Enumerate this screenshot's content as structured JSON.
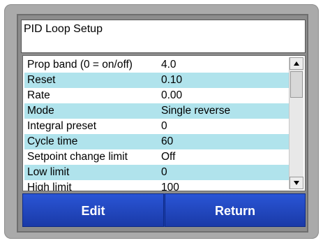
{
  "window": {
    "title": "PID Loop Setup"
  },
  "settings": [
    {
      "label": "Prop band (0 = on/off)",
      "value": "4.0"
    },
    {
      "label": "Reset",
      "value": "0.10"
    },
    {
      "label": "Rate",
      "value": "0.00"
    },
    {
      "label": "Mode",
      "value": "Single reverse"
    },
    {
      "label": "Integral preset",
      "value": "0"
    },
    {
      "label": "Cycle time",
      "value": "60"
    },
    {
      "label": "Setpoint change limit",
      "value": "Off"
    },
    {
      "label": "Low limit",
      "value": "0"
    },
    {
      "label": "High limit",
      "value": "100"
    }
  ],
  "scrollbar": {
    "up_icon": "triangle-up",
    "down_icon": "triangle-down"
  },
  "buttons": {
    "edit_label": "Edit",
    "return_label": "Return"
  },
  "colors": {
    "row_highlight": "#b0e3ec",
    "button_blue": "#1f47c4"
  }
}
